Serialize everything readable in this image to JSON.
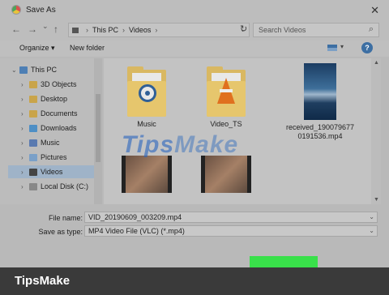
{
  "window": {
    "title": "Save As"
  },
  "address": {
    "back": "←",
    "forward": "→",
    "history": "⌄",
    "up": "↑",
    "path": [
      "This PC",
      "Videos"
    ],
    "refresh": "↻",
    "search_placeholder": "Search Videos"
  },
  "toolbar": {
    "organize_label": "Organize",
    "new_folder_label": "New folder"
  },
  "sidebar": {
    "items": [
      {
        "label": "This PC",
        "icon": "pc-icon"
      },
      {
        "label": "3D Objects",
        "icon": "folder-icon"
      },
      {
        "label": "Desktop",
        "icon": "folder-icon"
      },
      {
        "label": "Documents",
        "icon": "folder-icon"
      },
      {
        "label": "Downloads",
        "icon": "download-icon"
      },
      {
        "label": "Music",
        "icon": "music-icon"
      },
      {
        "label": "Pictures",
        "icon": "pictures-icon"
      },
      {
        "label": "Videos",
        "icon": "video-icon",
        "selected": true
      },
      {
        "label": "Local Disk (C:)",
        "icon": "disk-icon"
      }
    ]
  },
  "files": [
    {
      "name": "Music",
      "kind": "folder"
    },
    {
      "name": "Video_TS",
      "kind": "folder"
    },
    {
      "name": "received_1900796770191536.mp4",
      "kind": "video"
    },
    {
      "name": "",
      "kind": "video"
    },
    {
      "name": "",
      "kind": "video"
    }
  ],
  "form": {
    "file_name_label": "File name:",
    "file_name_value": "VID_20190609_003209.mp4",
    "save_type_label": "Save as type:",
    "save_type_value": "MP4 Video File (VLC) (*.mp4)"
  },
  "watermark": {
    "tips": "Tips",
    "make": "Make"
  },
  "brand": "TipsMake",
  "colors": {
    "highlight": "#39e04a",
    "selection": "#9fb3c8",
    "accent": "#3d6fa3"
  }
}
